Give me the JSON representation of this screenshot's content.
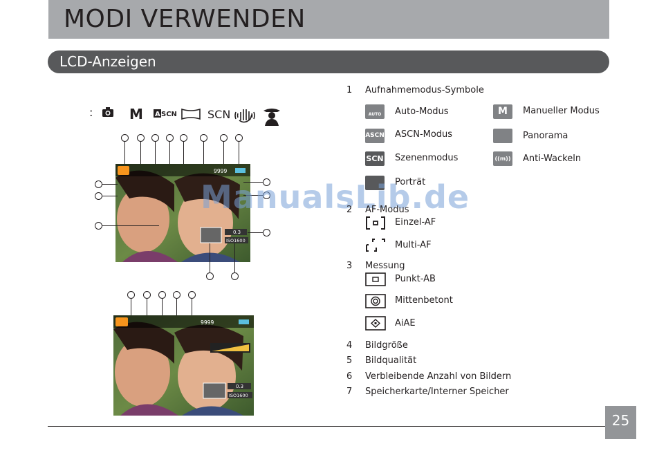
{
  "header": {
    "title": "MODI VERWENDEN"
  },
  "section": {
    "title": "LCD-Anzeigen"
  },
  "mode_row": {
    "colon": ":",
    "icons": [
      "camera-icon",
      "manual-m-icon",
      "ascn-icon",
      "panorama-icon",
      "scn-icon",
      "anti-shake-hand-icon",
      "portrait-icon"
    ]
  },
  "screen": {
    "shot_count": "9999",
    "ev_value": "0.3",
    "iso_value": "ISO1600"
  },
  "watermark": "ManualsLib.de",
  "legend": {
    "item1": {
      "num": "1",
      "label": "Aufnahmemodus-Symbole"
    },
    "modes": [
      {
        "icon_text": "AUTO",
        "label": "Auto-Modus"
      },
      {
        "icon_text": "M",
        "label": "Manueller Modus"
      },
      {
        "icon_text": "ASCN",
        "label": "ASCN-Modus"
      },
      {
        "icon_text": "",
        "label": "Panorama"
      },
      {
        "icon_text": "SCN",
        "label": "Szenenmodus"
      },
      {
        "icon_text": "((m))",
        "label": "Anti-Wackeln"
      },
      {
        "icon_text": "",
        "label": "Porträt"
      }
    ],
    "item2": {
      "num": "2",
      "label": "AF-Modus"
    },
    "af": [
      {
        "label": "Einzel-AF"
      },
      {
        "label": "Multi-AF"
      }
    ],
    "item3": {
      "num": "3",
      "label": "Messung"
    },
    "metering": [
      {
        "label": "Punkt-AB"
      },
      {
        "label": "Mittenbetont"
      },
      {
        "label": "AiAE"
      }
    ],
    "items": [
      {
        "num": "4",
        "label": "Bildgröße"
      },
      {
        "num": "5",
        "label": "Bildqualität"
      },
      {
        "num": "6",
        "label": "Verbleibende Anzahl von Bildern"
      },
      {
        "num": "7",
        "label": "Speicherkarte/Interner Speicher"
      }
    ]
  },
  "footer": {
    "page_number": "25"
  },
  "colors": {
    "title_bar": "#a7a9ac",
    "section_bar": "#58595b",
    "page_box": "#939598",
    "accent_orange": "#f7941d"
  }
}
